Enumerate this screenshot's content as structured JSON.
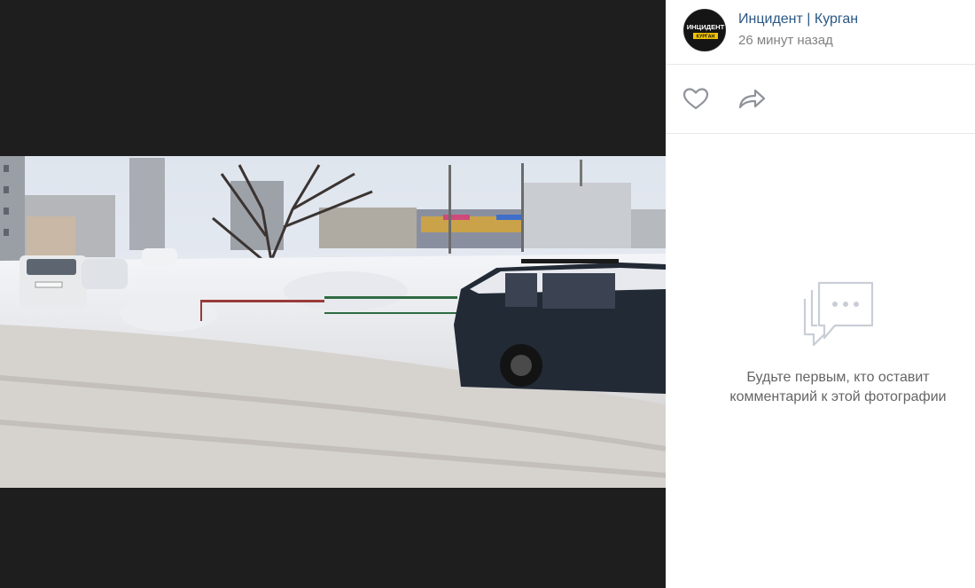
{
  "post": {
    "author": "Инцидент | Курган",
    "time": "26 минут назад"
  },
  "avatar": {
    "logo_line1": "ИНЦИДЕНТ",
    "logo_line2": "КУРГАН",
    "accent": "#f2c400"
  },
  "actions": {
    "like_icon": "heart-icon",
    "share_icon": "share-arrow-icon"
  },
  "comments": {
    "empty_icon": "comment-bubbles-icon",
    "empty_line1": "Будьте первым, кто оставит",
    "empty_line2": "комментарий к этой фотографии"
  },
  "colors": {
    "link": "#2a5885",
    "muted": "#828282",
    "viewer_bg": "#1e1e1e"
  }
}
